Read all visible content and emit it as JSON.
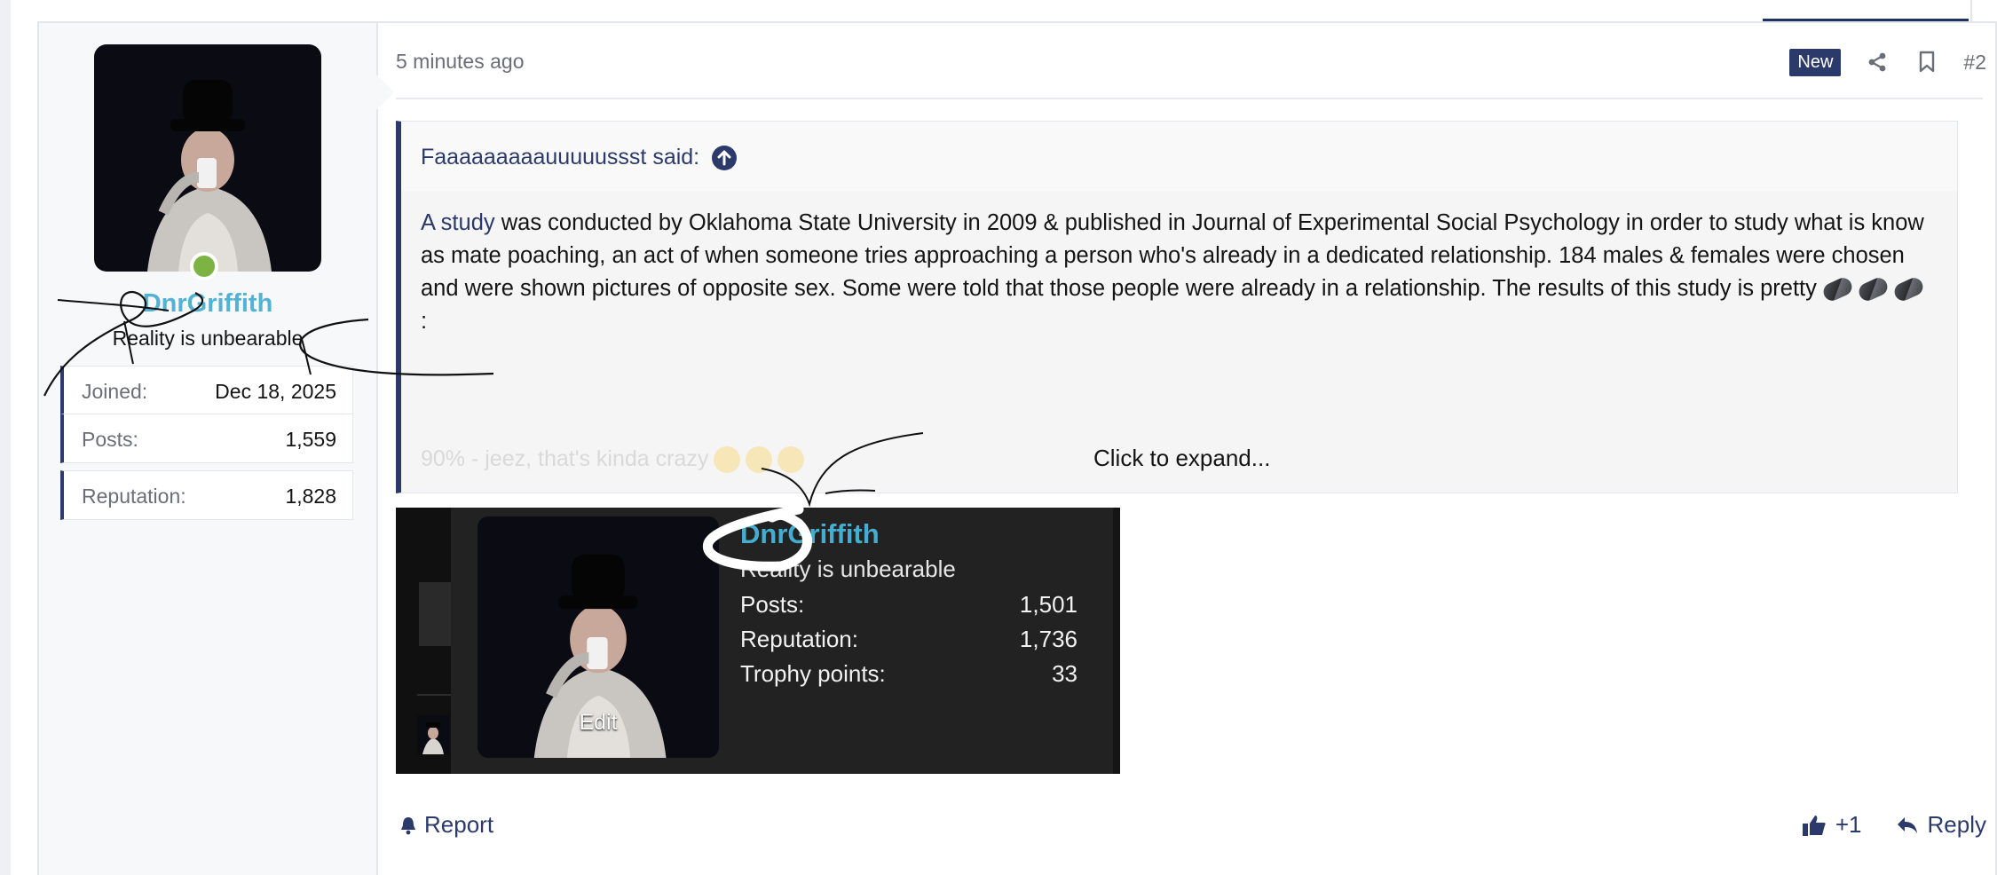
{
  "post": {
    "time": "5 minutes ago",
    "badge": "New",
    "number": "#2",
    "author": {
      "name": "DnrGriffith",
      "title": "Reality is unbearable",
      "stats": [
        {
          "key": "Joined:",
          "value": "Dec 18, 2025"
        },
        {
          "key": "Posts:",
          "value": "1,559"
        },
        {
          "key": "Reputation:",
          "value": "1,828"
        }
      ]
    },
    "quote": {
      "author": "Faaaaaaaaauuuuussst said:",
      "link_text": "A study",
      "text": " was conducted by Oklahoma State University in 2009 & published in Journal of Experimental Social Psychology in order to study what is know as mate poaching, an act of when someone tries approaching a person who's already in a dedicated relationship. 184 males & females were chosen and were shown pictures of opposite sex. Some were told that those people were already in a relationship. The results of this study is pretty ",
      "text_end": ":",
      "faded": "90% - jeez, that's kinda crazy",
      "expand": "Click to expand..."
    },
    "popup": {
      "name": "DnrGriffith",
      "title": "Reality is unbearable",
      "edit": "Edit",
      "stats": [
        {
          "key": "Posts:",
          "value": "1,501"
        },
        {
          "key": "Reputation:",
          "value": "1,736"
        },
        {
          "key": "Trophy points:",
          "value": "33"
        }
      ]
    },
    "footer": {
      "report": "Report",
      "like": "+1",
      "reply": "Reply"
    }
  },
  "icons": [
    "share-icon",
    "bookmark-icon",
    "arrow-up-circle-icon",
    "bell-icon",
    "thumbs-up-icon",
    "reply-icon"
  ],
  "colors": {
    "accent": "#2b3a6b",
    "username": "#52b2d3",
    "online": "#7cb342"
  }
}
